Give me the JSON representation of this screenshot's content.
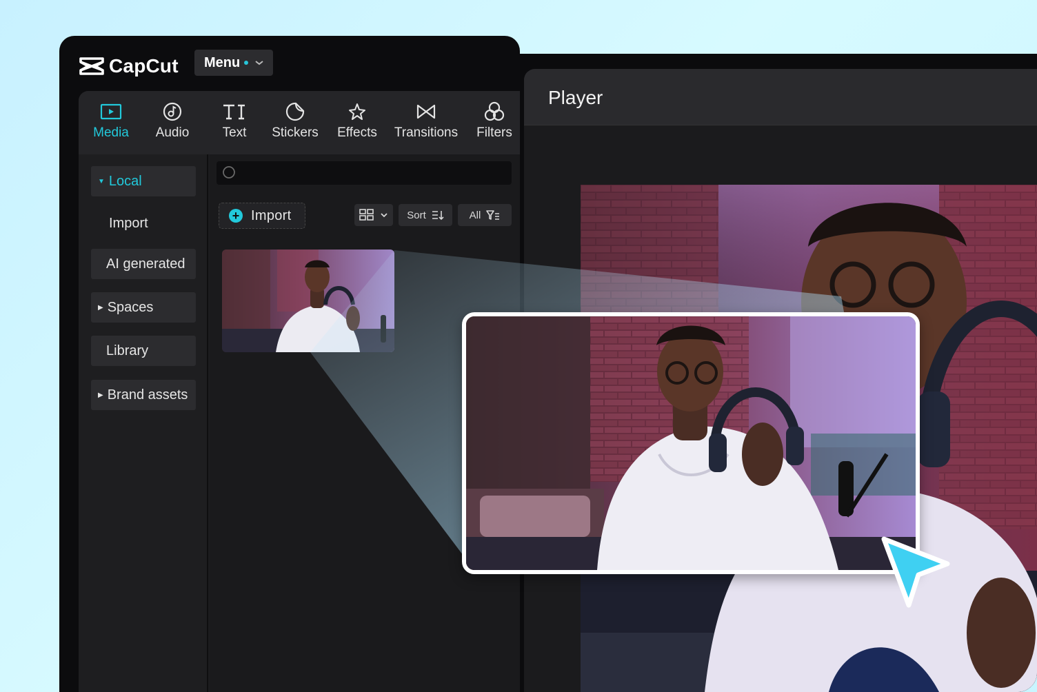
{
  "app": {
    "name": "CapCut",
    "menu_label": "Menu"
  },
  "tabs": [
    {
      "label": "Media",
      "icon": "media-icon",
      "active": true
    },
    {
      "label": "Audio",
      "icon": "audio-icon",
      "active": false
    },
    {
      "label": "Text",
      "icon": "text-icon",
      "active": false
    },
    {
      "label": "Stickers",
      "icon": "stickers-icon",
      "active": false
    },
    {
      "label": "Effects",
      "icon": "effects-icon",
      "active": false
    },
    {
      "label": "Transitions",
      "icon": "transitions-icon",
      "active": false
    },
    {
      "label": "Filters",
      "icon": "filters-icon",
      "active": false
    }
  ],
  "sidebar": {
    "items": [
      {
        "label": "Local",
        "caret": "down",
        "active": true
      },
      {
        "label": "Import",
        "sub": true
      },
      {
        "label": "AI generated"
      },
      {
        "label": "Spaces",
        "caret": "right"
      },
      {
        "label": "Library"
      },
      {
        "label": "Brand assets",
        "caret": "right"
      }
    ]
  },
  "media_panel": {
    "search_placeholder": "",
    "import_label": "Import",
    "sort_label": "Sort",
    "filter_label": "All"
  },
  "player": {
    "title": "Player"
  },
  "colors": {
    "accent": "#22c9db",
    "cursor": "#3fd0f2"
  }
}
